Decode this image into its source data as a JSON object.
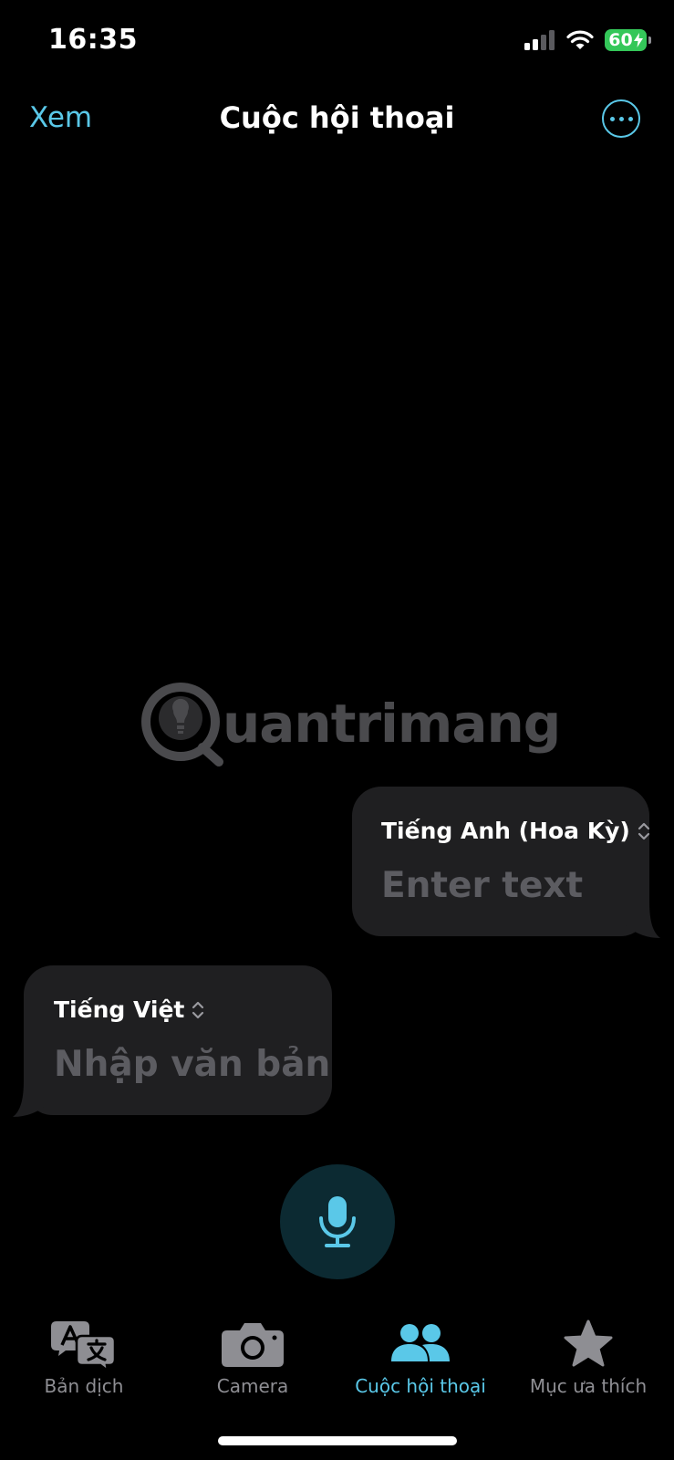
{
  "status_bar": {
    "time": "16:35",
    "battery": "60",
    "icons": [
      "signal-icon",
      "wifi-icon",
      "battery-charging-icon"
    ]
  },
  "nav": {
    "left_button": "Xem",
    "title": "Cuộc hội thoại",
    "more_icon": "ellipsis-circle-icon"
  },
  "watermark": {
    "text": "uantrimang"
  },
  "conversation": {
    "right_bubble": {
      "language": "Tiếng Anh (Hoa Kỳ)",
      "placeholder": "Enter text"
    },
    "left_bubble": {
      "language": "Tiếng Việt",
      "placeholder": "Nhập văn bản"
    }
  },
  "mic": {
    "icon": "microphone-icon"
  },
  "tabs": [
    {
      "label": "Bản dịch",
      "icon": "translate-icon",
      "active": false
    },
    {
      "label": "Camera",
      "icon": "camera-icon",
      "active": false
    },
    {
      "label": "Cuộc hội thoại",
      "icon": "people-icon",
      "active": true
    },
    {
      "label": "Mục ưa thích",
      "icon": "star-icon",
      "active": false
    }
  ],
  "colors": {
    "accent": "#5ac8e8",
    "background": "#000000",
    "bubble": "#1f1f21",
    "placeholder": "#5c5c61",
    "inactive": "#8e8e93",
    "battery": "#34c759"
  }
}
